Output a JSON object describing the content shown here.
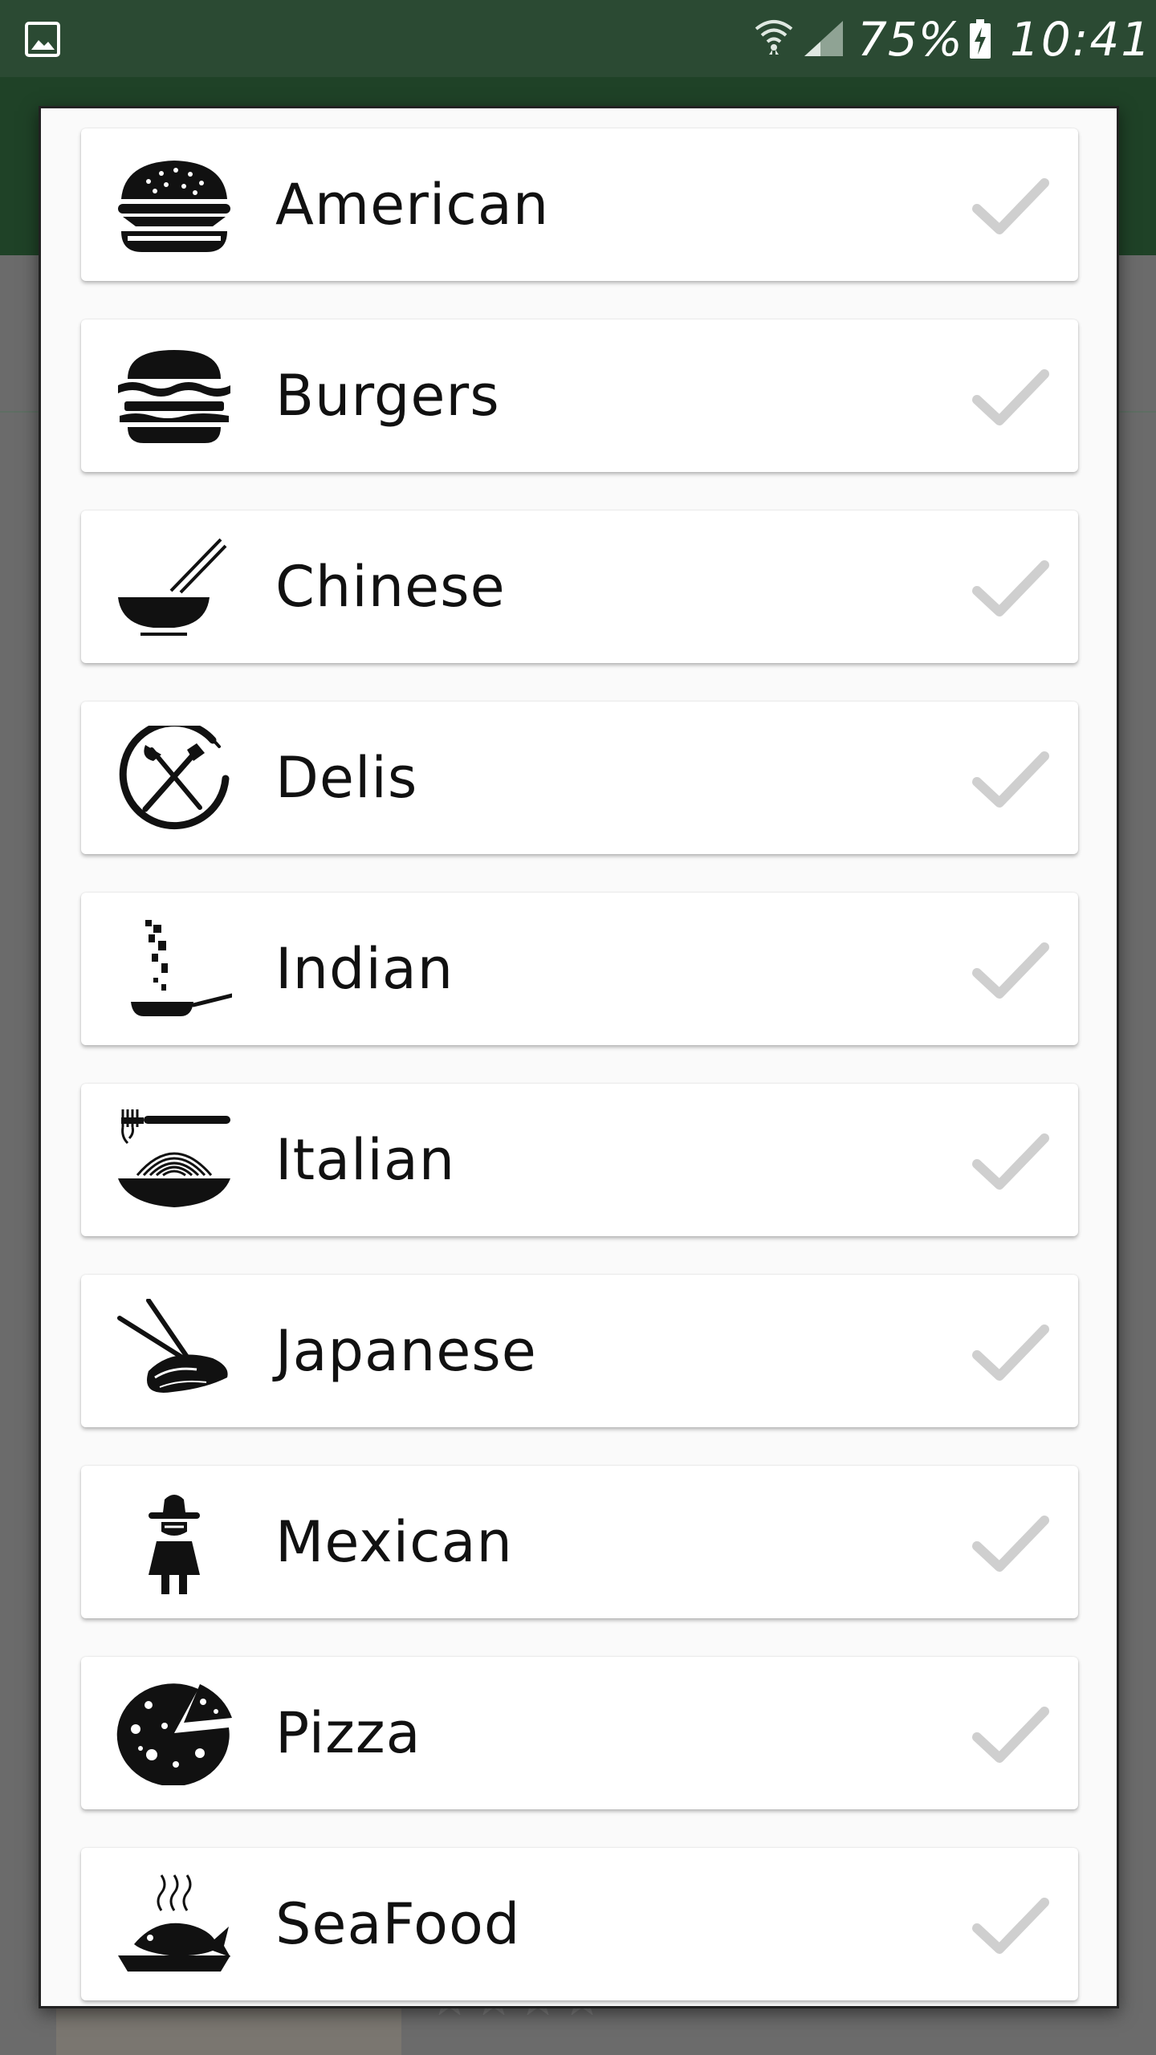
{
  "status_bar": {
    "battery_percent": "75%",
    "time": "10:41",
    "icons": [
      "gallery-icon",
      "wifi-icon",
      "signal-icon",
      "battery-charging-icon"
    ]
  },
  "colors": {
    "status_bar": "#2b4a33",
    "app_bar_dimmed": "#1f4227",
    "scrim": "#6b6b6b",
    "card": "#ffffff",
    "check_inactive": "#cccccc",
    "text": "#111111"
  },
  "dialog": {
    "items": [
      {
        "label": "American",
        "icon": "burger-icon",
        "checked": false
      },
      {
        "label": "Burgers",
        "icon": "burger-stack-icon",
        "checked": false
      },
      {
        "label": "Chinese",
        "icon": "bowl-chopsticks-icon",
        "checked": false
      },
      {
        "label": "Delis",
        "icon": "plate-fork-knife-icon",
        "checked": false
      },
      {
        "label": "Indian",
        "icon": "frying-pan-icon",
        "checked": false
      },
      {
        "label": "Italian",
        "icon": "pasta-fork-icon",
        "checked": false
      },
      {
        "label": "Japanese",
        "icon": "sushi-chopsticks-icon",
        "checked": false
      },
      {
        "label": "Mexican",
        "icon": "sombrero-person-icon",
        "checked": false
      },
      {
        "label": "Pizza",
        "icon": "pizza-icon",
        "checked": false
      },
      {
        "label": "SeaFood",
        "icon": "fish-plate-icon",
        "checked": false
      }
    ]
  }
}
